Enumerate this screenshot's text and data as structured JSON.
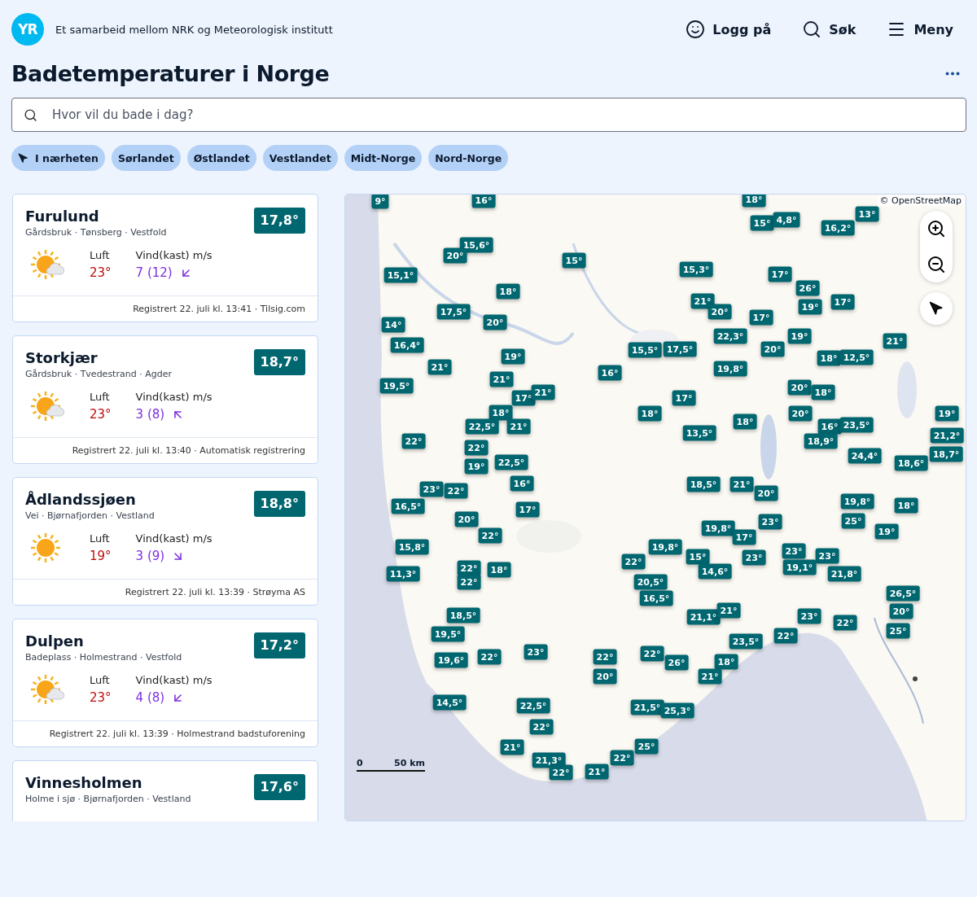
{
  "header": {
    "logo": "YR",
    "tagline": "Et samarbeid mellom NRK og Meteorologisk institutt",
    "actions": [
      {
        "kind": "login",
        "label": "Logg på"
      },
      {
        "kind": "search",
        "label": "Søk"
      },
      {
        "kind": "menu",
        "label": "Meny"
      }
    ]
  },
  "title": "Badetemperaturer i Norge",
  "search": {
    "placeholder": "Hvor vil du bade i dag?"
  },
  "regions": [
    {
      "label": "I nærheten",
      "kind": "nearby"
    },
    {
      "label": "Sørlandet"
    },
    {
      "label": "Østlandet"
    },
    {
      "label": "Vestlandet"
    },
    {
      "label": "Midt-Norge"
    },
    {
      "label": "Nord-Norge"
    }
  ],
  "spots": [
    {
      "name": "Furulund",
      "meta": "Gårdsbruk · Tønsberg · Vestfold",
      "water": "17,8°",
      "sky": {
        "kind": "sun_cloud"
      },
      "air_label": "Luft",
      "wind_label": "Vind(kast) m/s",
      "air": "23°",
      "wind": "7 (12)",
      "wind_arrow": {
        "kind": "sw"
      },
      "footer": "Registrert 22. juli kl. 13:41 · Tilsig.com"
    },
    {
      "name": "Storkjær",
      "meta": "Gårdsbruk · Tvedestrand · Agder",
      "water": "18,7°",
      "sky": {
        "kind": "sun_cloud"
      },
      "air_label": "Luft",
      "wind_label": "Vind(kast) m/s",
      "air": "23°",
      "wind": "3 (8)",
      "wind_arrow": {
        "kind": "nw"
      },
      "footer": "Registrert 22. juli kl. 13:40 · Automatisk registrering"
    },
    {
      "name": "Ådlandssjøen",
      "meta": "Vei · Bjørnafjorden · Vestland",
      "water": "18,8°",
      "sky": {
        "kind": "sun"
      },
      "air_label": "Luft",
      "wind_label": "Vind(kast) m/s",
      "air": "19°",
      "wind": "3 (9)",
      "wind_arrow": {
        "kind": "se"
      },
      "footer": "Registrert 22. juli kl. 13:39 · Strøyma AS"
    },
    {
      "name": "Dulpen",
      "meta": "Badeplass · Holmestrand · Vestfold",
      "water": "17,2°",
      "sky": {
        "kind": "sun_cloud"
      },
      "air_label": "Luft",
      "wind_label": "Vind(kast) m/s",
      "air": "23°",
      "wind": "4 (8)",
      "wind_arrow": {
        "kind": "sw"
      },
      "footer": "Registrert 22. juli kl. 13:39 · Holmestrand badstuforening"
    },
    {
      "name": "Vinnesholmen",
      "meta": "Holme i sjø · Bjørnafjorden · Vestland",
      "water": "17,6°"
    }
  ],
  "map": {
    "attribution": "© OpenStreetMap",
    "scale": [
      "0",
      "50 km"
    ],
    "markers": [
      "9°",
      "16°",
      "18°",
      "15,6°",
      "20°",
      "15,1°",
      "15°",
      "15°",
      "4,8°",
      "13°",
      "16,2°",
      "15,3°",
      "17°",
      "26°",
      "18°",
      "17,5°",
      "20°",
      "21°",
      "20°",
      "19°",
      "17°",
      "17°",
      "14°",
      "16,4°",
      "22,3°",
      "15,5°",
      "17,5°",
      "19°",
      "21°",
      "20°",
      "18°",
      "12,5°",
      "19,8°",
      "19°",
      "16°",
      "21°",
      "19,5°",
      "21°",
      "17°",
      "21°",
      "20°",
      "18°",
      "17°",
      "18°",
      "22,5°",
      "21°",
      "18°",
      "18°",
      "13,5°",
      "20°",
      "16°",
      "23,5°",
      "18,9°",
      "19°",
      "21,2°",
      "22°",
      "22°",
      "19°",
      "22,5°",
      "24,4°",
      "18,6°",
      "18,7°",
      "16°",
      "18,5°",
      "21°",
      "20°",
      "19,8°",
      "18°",
      "23°",
      "22°",
      "16,5°",
      "17°",
      "20°",
      "22°",
      "19,8°",
      "17°",
      "23°",
      "25°",
      "19°",
      "19,8°",
      "22°",
      "15,8°",
      "15°",
      "23°",
      "23°",
      "23°",
      "11,3°",
      "22°",
      "18°",
      "22°",
      "14,6°",
      "19,1°",
      "21,8°",
      "20,5°",
      "16,5°",
      "18,5°",
      "19,5°",
      "19,6°",
      "22°",
      "23°",
      "21,1°",
      "21°",
      "23°",
      "22°",
      "26,5°",
      "20°",
      "25°",
      "22°",
      "22°",
      "23,5°",
      "22°",
      "20°",
      "26°",
      "18°",
      "21°",
      "14,5°",
      "22,5°",
      "22°",
      "21,5°",
      "25,3°",
      "25°",
      "21°",
      "22°",
      "21,3°",
      "22°",
      "21°"
    ]
  }
}
